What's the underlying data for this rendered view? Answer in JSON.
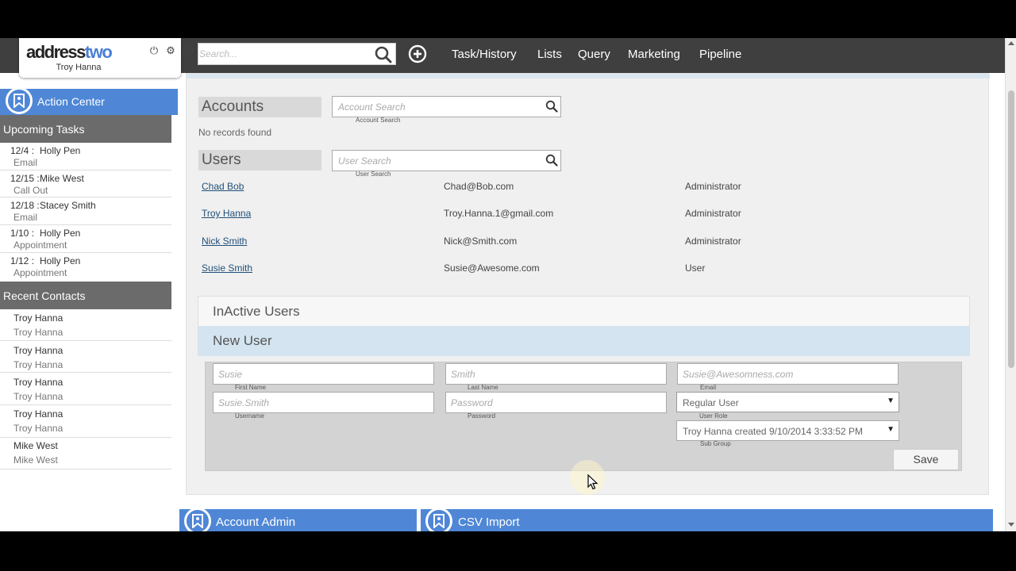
{
  "header": {
    "logo": {
      "part1": "address",
      "part2": "two",
      "user": "Troy Hanna"
    },
    "search_placeholder": "Search...",
    "nav": [
      "Task/History",
      "Lists",
      "Query",
      "Marketing",
      "Pipeline"
    ]
  },
  "sidebar": {
    "action_center": "Action Center",
    "upcoming_title": "Upcoming Tasks",
    "tasks": [
      {
        "date": "12/4 :",
        "name": "Holly Pen",
        "type": "Email"
      },
      {
        "date": "12/15 :",
        "name": "Mike West",
        "type": "Call Out"
      },
      {
        "date": "12/18 :",
        "name": "Stacey Smith",
        "type": "Email"
      },
      {
        "date": "1/10 :",
        "name": "Holly Pen",
        "type": "Appointment"
      },
      {
        "date": "1/12 :",
        "name": "Holly Pen",
        "type": "Appointment"
      }
    ],
    "recent_title": "Recent Contacts",
    "contacts": [
      {
        "name": "Troy Hanna",
        "sub": "Troy Hanna"
      },
      {
        "name": "Troy Hanna",
        "sub": "Troy Hanna"
      },
      {
        "name": "Troy Hanna",
        "sub": "Troy Hanna"
      },
      {
        "name": "Troy Hanna",
        "sub": "Troy Hanna"
      },
      {
        "name": "Mike West",
        "sub": "Mike West"
      }
    ]
  },
  "accounts": {
    "title": "Accounts",
    "search_placeholder": "Account Search",
    "search_label": "Account Search",
    "empty": "No records found"
  },
  "users": {
    "title": "Users",
    "search_placeholder": "User Search",
    "search_label": "User Search",
    "rows": [
      {
        "name": "Chad Bob",
        "email": "Chad@Bob.com",
        "role": "Administrator"
      },
      {
        "name": "Troy Hanna",
        "email": "Troy.Hanna.1@gmail.com",
        "role": "Administrator"
      },
      {
        "name": "Nick Smith",
        "email": "Nick@Smith.com",
        "role": "Administrator"
      },
      {
        "name": "Susie Smith",
        "email": "Susie@Awesome.com",
        "role": "User"
      }
    ]
  },
  "accordion": {
    "inactive": "InActive Users",
    "new_user": "New User"
  },
  "new_user_form": {
    "first_name": {
      "placeholder": "Susie",
      "label": "First Name"
    },
    "last_name": {
      "placeholder": "Smith",
      "label": "Last Name"
    },
    "email": {
      "placeholder": "Susie@Awesomness.com",
      "label": "Email"
    },
    "username": {
      "placeholder": "Susie.Smith",
      "label": "Username"
    },
    "password": {
      "placeholder": "Password",
      "label": "Password"
    },
    "user_role": {
      "value": "Regular User",
      "label": "User Role"
    },
    "sub_group": {
      "value": "Troy Hanna created 9/10/2014 3:33:52 PM",
      "label": "Sub Group"
    },
    "save_label": "Save"
  },
  "bottom_tiles": [
    "Account Admin",
    "CSV Import"
  ],
  "colors": {
    "accent": "#4f87d6",
    "topbar": "#3f3f3f",
    "sidebar_header": "#6b6b6b"
  }
}
